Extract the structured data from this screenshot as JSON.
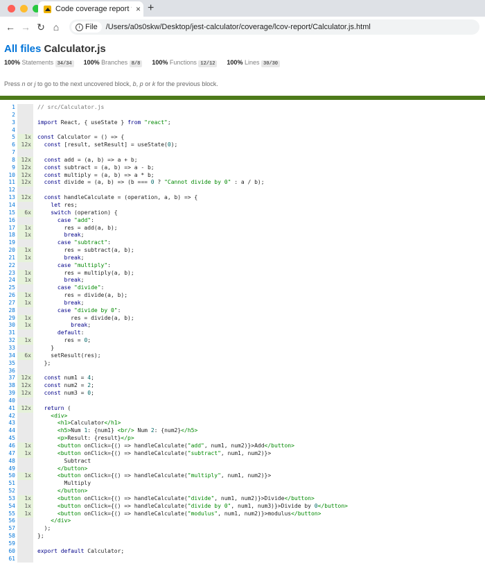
{
  "browser": {
    "tab_title": "Code coverage report for Calculator.js",
    "new_tab": "+",
    "close": "×",
    "chip_label": "File",
    "url": "/Users/a0s0skw/Desktop/jest-calculator/coverage/lcov-report/Calculator.js.html",
    "colors": {
      "red": "#ff5f57",
      "yellow": "#febc2e",
      "green": "#28c840"
    }
  },
  "header": {
    "crumb": "All files",
    "filename": "Calculator.js",
    "stats": [
      {
        "pct": "100%",
        "label": "Statements",
        "fraction": "34/34"
      },
      {
        "pct": "100%",
        "label": "Branches",
        "fraction": "8/8"
      },
      {
        "pct": "100%",
        "label": "Functions",
        "fraction": "12/12"
      },
      {
        "pct": "100%",
        "label": "Lines",
        "fraction": "30/30"
      }
    ],
    "hint_parts": [
      "Press ",
      "n",
      " or ",
      "j",
      " to go to the next uncovered block, ",
      "b",
      ", ",
      "p",
      " or ",
      "k",
      " for the previous block."
    ]
  },
  "code": {
    "lines": [
      {
        "n": "1",
        "hits": "",
        "text": "// src/Calculator.js"
      },
      {
        "n": "2",
        "hits": "",
        "text": ""
      },
      {
        "n": "3",
        "hits": "",
        "text": "import React, { useState } from \"react\";"
      },
      {
        "n": "4",
        "hits": "",
        "text": ""
      },
      {
        "n": "5",
        "hits": "1x",
        "text": "const Calculator = () => {"
      },
      {
        "n": "6",
        "hits": "12x",
        "text": "  const [result, setResult] = useState(0);"
      },
      {
        "n": "7",
        "hits": "",
        "text": ""
      },
      {
        "n": "8",
        "hits": "12x",
        "text": "  const add = (a, b) => a + b;"
      },
      {
        "n": "9",
        "hits": "12x",
        "text": "  const subtract = (a, b) => a - b;"
      },
      {
        "n": "10",
        "hits": "12x",
        "text": "  const multiply = (a, b) => a * b;"
      },
      {
        "n": "11",
        "hits": "12x",
        "text": "  const divide = (a, b) => (b === 0 ? \"Cannot divide by 0\" : a / b);"
      },
      {
        "n": "12",
        "hits": "",
        "text": ""
      },
      {
        "n": "13",
        "hits": "12x",
        "text": "  const handleCalculate = (operation, a, b) => {"
      },
      {
        "n": "14",
        "hits": "",
        "text": "    let res;"
      },
      {
        "n": "15",
        "hits": "6x",
        "text": "    switch (operation) {"
      },
      {
        "n": "16",
        "hits": "",
        "text": "      case \"add\":"
      },
      {
        "n": "17",
        "hits": "1x",
        "text": "        res = add(a, b);"
      },
      {
        "n": "18",
        "hits": "1x",
        "text": "        break;"
      },
      {
        "n": "19",
        "hits": "",
        "text": "      case \"subtract\":"
      },
      {
        "n": "20",
        "hits": "1x",
        "text": "        res = subtract(a, b);"
      },
      {
        "n": "21",
        "hits": "1x",
        "text": "        break;"
      },
      {
        "n": "22",
        "hits": "",
        "text": "      case \"multiply\":"
      },
      {
        "n": "23",
        "hits": "1x",
        "text": "        res = multiply(a, b);"
      },
      {
        "n": "24",
        "hits": "1x",
        "text": "        break;"
      },
      {
        "n": "25",
        "hits": "",
        "text": "      case \"divide\":"
      },
      {
        "n": "26",
        "hits": "1x",
        "text": "        res = divide(a, b);"
      },
      {
        "n": "27",
        "hits": "1x",
        "text": "        break;"
      },
      {
        "n": "28",
        "hits": "",
        "text": "      case \"divide by 0\":"
      },
      {
        "n": "29",
        "hits": "1x",
        "text": "          res = divide(a, b);"
      },
      {
        "n": "30",
        "hits": "1x",
        "text": "          break;"
      },
      {
        "n": "31",
        "hits": "",
        "text": "      default:"
      },
      {
        "n": "32",
        "hits": "1x",
        "text": "        res = 0;"
      },
      {
        "n": "33",
        "hits": "",
        "text": "    }"
      },
      {
        "n": "34",
        "hits": "6x",
        "text": "    setResult(res);"
      },
      {
        "n": "35",
        "hits": "",
        "text": "  };"
      },
      {
        "n": "36",
        "hits": "",
        "text": ""
      },
      {
        "n": "37",
        "hits": "12x",
        "text": "  const num1 = 4;"
      },
      {
        "n": "38",
        "hits": "12x",
        "text": "  const num2 = 2;"
      },
      {
        "n": "39",
        "hits": "12x",
        "text": "  const num3 = 0;"
      },
      {
        "n": "40",
        "hits": "",
        "text": ""
      },
      {
        "n": "41",
        "hits": "12x",
        "text": "  return ("
      },
      {
        "n": "42",
        "hits": "",
        "text": "    <div>"
      },
      {
        "n": "43",
        "hits": "",
        "text": "      <h1>Calculator</h1>"
      },
      {
        "n": "44",
        "hits": "",
        "text": "      <h5>Num 1: {num1} <br/> Num 2: {num2}</h5>"
      },
      {
        "n": "45",
        "hits": "",
        "text": "      <p>Result: {result}</p>"
      },
      {
        "n": "46",
        "hits": "1x",
        "text": "      <button onClick={() => handleCalculate(\"add\", num1, num2)}>Add</button>"
      },
      {
        "n": "47",
        "hits": "1x",
        "text": "      <button onClick={() => handleCalculate(\"subtract\", num1, num2)}>"
      },
      {
        "n": "48",
        "hits": "",
        "text": "        Subtract"
      },
      {
        "n": "49",
        "hits": "",
        "text": "      </button>"
      },
      {
        "n": "50",
        "hits": "1x",
        "text": "      <button onClick={() => handleCalculate(\"multiply\", num1, num2)}>"
      },
      {
        "n": "51",
        "hits": "",
        "text": "        Multiply"
      },
      {
        "n": "52",
        "hits": "",
        "text": "      </button>"
      },
      {
        "n": "53",
        "hits": "1x",
        "text": "      <button onClick={() => handleCalculate(\"divide\", num1, num2)}>Divide</button>"
      },
      {
        "n": "54",
        "hits": "1x",
        "text": "      <button onClick={() => handleCalculate(\"divide by 0\", num1, num3)}>Divide by 0</button>"
      },
      {
        "n": "55",
        "hits": "1x",
        "text": "      <button onClick={() => handleCalculate(\"modulus\", num1, num2)}>modulus</button>"
      },
      {
        "n": "56",
        "hits": "",
        "text": "    </div>"
      },
      {
        "n": "57",
        "hits": "",
        "text": "  );"
      },
      {
        "n": "58",
        "hits": "",
        "text": "};"
      },
      {
        "n": "59",
        "hits": "",
        "text": ""
      },
      {
        "n": "60",
        "hits": "",
        "text": "export default Calculator;"
      },
      {
        "n": "61",
        "hits": "",
        "text": ""
      }
    ]
  }
}
